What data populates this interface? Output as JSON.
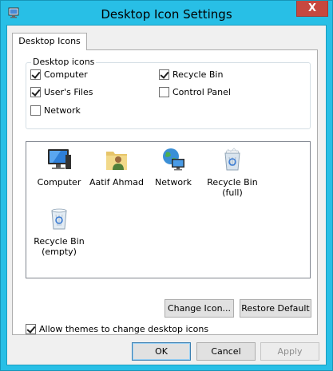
{
  "window": {
    "title": "Desktop Icon Settings",
    "close_glyph": "X"
  },
  "tab": {
    "label": "Desktop Icons"
  },
  "group": {
    "label": "Desktop icons",
    "checkboxes": [
      {
        "label": "Computer",
        "checked": true
      },
      {
        "label": "User's Files",
        "checked": true
      },
      {
        "label": "Network",
        "checked": false
      },
      {
        "label": "Recycle Bin",
        "checked": true
      },
      {
        "label": "Control Panel",
        "checked": false
      }
    ]
  },
  "icons": [
    {
      "label": "Computer",
      "icon": "computer-icon"
    },
    {
      "label": "Aatif Ahmad",
      "icon": "user-folder-icon"
    },
    {
      "label": "Network",
      "icon": "network-icon"
    },
    {
      "label": "Recycle Bin (full)",
      "icon": "recycle-bin-full-icon"
    },
    {
      "label": "Recycle Bin (empty)",
      "icon": "recycle-bin-empty-icon"
    }
  ],
  "buttons": {
    "change_icon": "Change Icon...",
    "restore_default": "Restore Default",
    "ok": "OK",
    "cancel": "Cancel",
    "apply": "Apply"
  },
  "themes_checkbox": {
    "label": "Allow themes to change desktop icons",
    "checked": true
  },
  "colors": {
    "frame": "#28bfe6",
    "close": "#c7483f"
  }
}
